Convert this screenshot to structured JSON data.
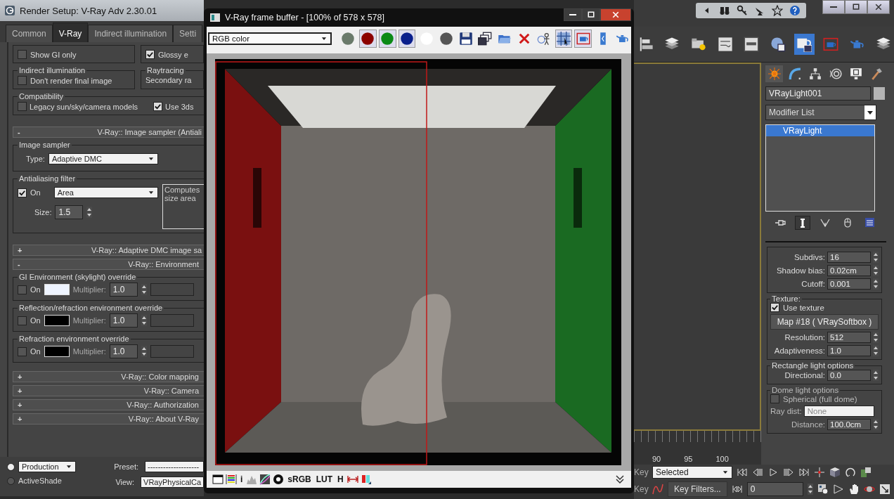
{
  "render_setup": {
    "title": "Render Setup: V-Ray Adv 2.30.01",
    "tabs": [
      {
        "label": "Common",
        "selected": false
      },
      {
        "label": "V-Ray",
        "selected": true
      },
      {
        "label": "Indirect illumination",
        "selected": false
      },
      {
        "label": "Setti",
        "selected": false
      }
    ],
    "gi_options": [
      {
        "label": "Show GI only",
        "checked": false
      },
      {
        "label": "Glossy e",
        "checked": true
      }
    ],
    "indirect_group": {
      "title": "Indirect illumination",
      "option": {
        "label": "Don't render final image",
        "checked": false
      }
    },
    "raytracing_group": {
      "title": "Raytracing",
      "text": "Secondary ra"
    },
    "compat_group": {
      "title": "Compatibility",
      "options": [
        {
          "label": "Legacy sun/sky/camera models",
          "checked": false
        },
        {
          "label": "Use 3ds",
          "checked": true
        }
      ]
    },
    "sampler_rollout": {
      "sign": "-",
      "title": "V-Ray:: Image sampler (Antiali"
    },
    "image_sampler": {
      "title": "Image sampler",
      "type_label": "Type:",
      "type": "Adaptive DMC"
    },
    "aa_filter": {
      "title": "Antialiasing filter",
      "on": {
        "label": "On",
        "checked": true
      },
      "filter": "Area",
      "description": [
        "Computes",
        "size area"
      ],
      "size_label": "Size:",
      "size": "1.5"
    },
    "dmc_rollout": {
      "sign": "+",
      "title": "V-Ray:: Adaptive DMC image sa"
    },
    "env_rollout": {
      "sign": "-",
      "title": "V-Ray:: Environment"
    },
    "env_groups": [
      {
        "title": "GI Environment (skylight) override",
        "on": {
          "label": "On",
          "checked": false
        },
        "color": "#eef4ff",
        "multiplier_label": "Multiplier:",
        "multiplier": "1.0"
      },
      {
        "title": "Reflection/refraction environment override",
        "on": {
          "label": "On",
          "checked": false
        },
        "color": "#000000",
        "multiplier_label": "Multiplier:",
        "multiplier": "1.0"
      },
      {
        "title": "Refraction environment override",
        "on": {
          "label": "On",
          "checked": false
        },
        "color": "#000000",
        "multiplier_label": "Multiplier:",
        "multiplier": "1.0"
      }
    ],
    "collapsed_rollouts": [
      {
        "sign": "+",
        "title": "V-Ray:: Color mapping"
      },
      {
        "sign": "+",
        "title": "V-Ray:: Camera"
      },
      {
        "sign": "+",
        "title": "V-Ray:: Authorization"
      },
      {
        "sign": "+",
        "title": "V-Ray:: About V-Ray"
      }
    ],
    "modes": [
      {
        "selected": true
      },
      {
        "label": "ActiveShade",
        "selected": false
      }
    ],
    "mode_dropdown": "Production",
    "preset_label": "Preset:",
    "preset": "--------------------",
    "view_label": "View:",
    "view": "VRayPhysicalCa"
  },
  "frame_buffer": {
    "title": "V-Ray frame buffer - [100% of 578 x 578]",
    "channel": "RGB color",
    "tools": [
      {
        "kind": "channel-dot",
        "color": "#6a7a6a",
        "on": false
      },
      {
        "kind": "channel-dot",
        "color": "#8b0000",
        "on": true
      },
      {
        "kind": "channel-dot",
        "color": "#0b8a16",
        "on": true
      },
      {
        "kind": "channel-dot",
        "color": "#0a1f8c",
        "on": true
      },
      {
        "kind": "channel-dot",
        "color": "#ffffff",
        "on": false
      },
      {
        "kind": "channel-dot",
        "color": "#555555",
        "on": false
      },
      {
        "kind": "floppy-disk",
        "on": false
      },
      {
        "kind": "stacked-windows",
        "on": false
      },
      {
        "kind": "folder",
        "on": false
      },
      {
        "kind": "cross",
        "on": false
      },
      {
        "kind": "person-target",
        "on": false
      },
      {
        "kind": "region-grid",
        "on": true
      },
      {
        "kind": "teapot-frame",
        "on": true
      },
      {
        "kind": "split-bar",
        "on": false
      },
      {
        "kind": "teapot",
        "on": false
      }
    ],
    "bottom_tools": [
      {
        "kind": "window"
      },
      {
        "kind": "color-bars"
      },
      {
        "kind": "text",
        "label": "i"
      },
      {
        "kind": "histogram"
      },
      {
        "kind": "color-curve"
      },
      {
        "kind": "circle-gear"
      },
      {
        "kind": "text",
        "label": "sRGB"
      },
      {
        "kind": "text",
        "label": "LUT"
      },
      {
        "kind": "text",
        "label": "H"
      },
      {
        "kind": "arrows-horizontal"
      },
      {
        "kind": "two-bars"
      }
    ]
  },
  "max": {
    "infocenter": [
      {
        "kind": "caret-left"
      },
      {
        "kind": "binoculars"
      },
      {
        "kind": "key"
      },
      {
        "kind": "satellite-dish"
      },
      {
        "kind": "star"
      },
      {
        "kind": "help"
      }
    ],
    "toolbar": [
      {
        "kind": "align-bars",
        "on": false
      },
      {
        "kind": "layers",
        "on": false
      },
      {
        "kind": "folder-bulb",
        "on": false
      },
      {
        "kind": "schematic",
        "on": false
      },
      {
        "kind": "window-panel",
        "on": false
      },
      {
        "kind": "sphere-grid",
        "on": false
      },
      {
        "kind": "teapot-setup",
        "on": true
      },
      {
        "kind": "teapot-frame",
        "on": false
      },
      {
        "kind": "teapot",
        "on": false
      },
      {
        "kind": "layers",
        "on": false
      }
    ],
    "command_tabs": [
      {
        "kind": "sun-burst",
        "selected": true
      },
      {
        "kind": "arc-curve",
        "selected": false
      },
      {
        "kind": "hierarchy",
        "selected": false
      },
      {
        "kind": "rings",
        "selected": false
      },
      {
        "kind": "monitor",
        "selected": false
      },
      {
        "kind": "hammer",
        "selected": false
      }
    ],
    "object_name": "VRayLight001",
    "modifier_list": "Modifier List",
    "stack": [
      {
        "label": "VRayLight",
        "selected": true
      }
    ],
    "stack_tools": [
      {
        "kind": "pin",
        "on": false
      },
      {
        "kind": "bar-slot",
        "on": true
      },
      {
        "kind": "fork",
        "on": false
      },
      {
        "kind": "mouse",
        "on": false
      },
      {
        "kind": "configure",
        "on": false
      }
    ],
    "sampling_params": [
      {
        "label": "Subdivs:",
        "value": "16"
      },
      {
        "label": "Shadow bias:",
        "value": "0.02cm"
      },
      {
        "label": "Cutoff:",
        "value": "0.001"
      }
    ],
    "texture": {
      "title": "Texture:",
      "use": {
        "label": "Use texture",
        "checked": true
      },
      "map": "Map #18  ( VRaySoftbox )",
      "params": [
        {
          "label": "Resolution:",
          "value": "512"
        },
        {
          "label": "Adaptiveness:",
          "value": "1.0"
        }
      ]
    },
    "rect_options": {
      "title": "Rectangle light options",
      "params": [
        {
          "label": "Directional:",
          "value": "0.0"
        }
      ]
    },
    "dome_options": {
      "title": "Dome light options",
      "spherical": {
        "label": "Spherical (full dome)",
        "checked": false
      },
      "ray_dist_label": "Ray dist:",
      "ray_dist": "None",
      "distance_label": "Distance:",
      "distance": "100.0cm"
    },
    "timeline_ticks": [
      "90",
      "95",
      "100"
    ],
    "key_labels": [
      "Key",
      "Key"
    ],
    "key_mode": "Selected",
    "key_filters": "Key Filters...",
    "frame": "0",
    "playback": [
      {
        "kind": "go-start"
      },
      {
        "kind": "prev-frame"
      },
      {
        "kind": "play"
      },
      {
        "kind": "next-frame"
      },
      {
        "kind": "go-end"
      }
    ],
    "nav_top": [
      {
        "kind": "move-pivot"
      },
      {
        "kind": "cube-shaded"
      },
      {
        "kind": "orbit"
      },
      {
        "kind": "viewport-box"
      }
    ],
    "nav_bottom": [
      {
        "kind": "time-config"
      },
      {
        "kind": "triangle-outline"
      },
      {
        "kind": "hand"
      },
      {
        "kind": "orbit-sphere"
      },
      {
        "kind": "maximize-corner"
      }
    ]
  }
}
